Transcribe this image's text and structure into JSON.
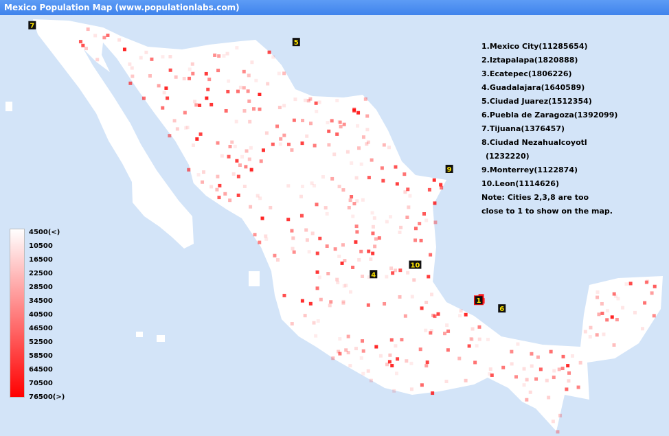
{
  "window": {
    "title": "Mexico Population Map (www.populationlabs.com)"
  },
  "colors": {
    "background": "#d3e4f8",
    "land": "#ffffff",
    "low": "#ffffff",
    "high": "#ff0000",
    "marker_bg": "#111111",
    "marker_text": "#ffe500"
  },
  "markers": [
    {
      "label": "1",
      "lon": -99.13,
      "lat": 19.43
    },
    {
      "label": "4",
      "lon": -103.35,
      "lat": 20.67
    },
    {
      "label": "5",
      "lon": -106.45,
      "lat": 31.72
    },
    {
      "label": "6",
      "lon": -98.2,
      "lat": 19.04
    },
    {
      "label": "7",
      "lon": -117.04,
      "lat": 32.52
    },
    {
      "label": "9",
      "lon": -100.31,
      "lat": 25.68
    },
    {
      "label": "10",
      "lon": -101.68,
      "lat": 21.12
    }
  ],
  "city_list": [
    "1.Mexico City(11285654)",
    "2.Iztapalapa(1820888)",
    "3.Ecatepec(1806226)",
    "4.Guadalajara(1640589)",
    "5.Ciudad Juarez(1512354)",
    "6.Puebla de Zaragoza(1392099)",
    "7.Tijuana(1376457)",
    "8.Ciudad Nezahualcoyotl",
    "(1232220)",
    "9.Monterrey(1122874)",
    "10.Leon(1114626)",
    "Note: Cities 2,3,8 are too",
    "close to 1 to show on the map."
  ],
  "legend": {
    "labels": [
      "4500(<)",
      "10500",
      "16500",
      "22500",
      "28500",
      "34500",
      "40500",
      "46500",
      "52500",
      "58500",
      "64500",
      "70500",
      "76500(>)"
    ]
  },
  "map_data": {
    "cities": [
      {
        "lon": -99.13,
        "lat": 19.43,
        "pop": 11285654
      },
      {
        "lon": -99.06,
        "lat": 19.36,
        "pop": 1820888
      },
      {
        "lon": -99.03,
        "lat": 19.6,
        "pop": 1806226
      },
      {
        "lon": -103.35,
        "lat": 20.67,
        "pop": 1640589
      },
      {
        "lon": -106.45,
        "lat": 31.72,
        "pop": 1512354
      },
      {
        "lon": -98.2,
        "lat": 19.04,
        "pop": 1392099
      },
      {
        "lon": -117.04,
        "lat": 32.52,
        "pop": 1376457
      },
      {
        "lon": -99.0,
        "lat": 19.4,
        "pop": 1232220
      },
      {
        "lon": -100.31,
        "lat": 25.68,
        "pop": 1122874
      },
      {
        "lon": -101.68,
        "lat": 21.12,
        "pop": 1114626
      }
    ]
  }
}
